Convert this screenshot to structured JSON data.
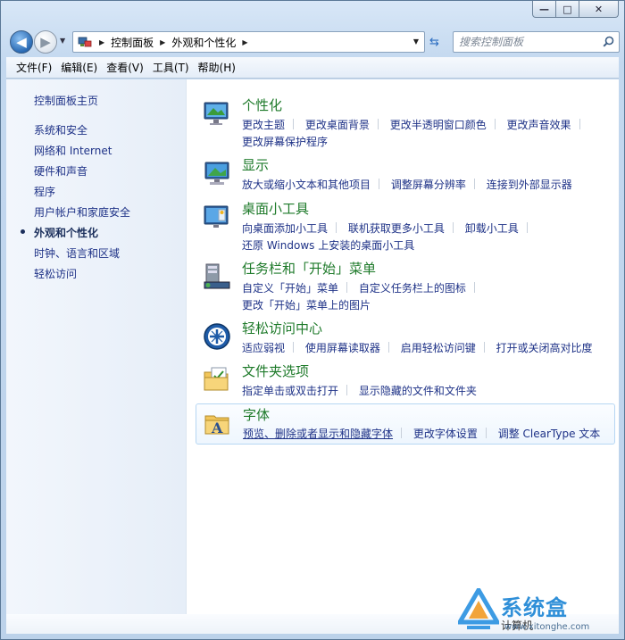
{
  "window": {
    "caption": {
      "min": "—",
      "max": "□",
      "close": "✕"
    }
  },
  "nav": {
    "back_icon": "arrow-left-icon",
    "forward_icon": "arrow-right-icon",
    "breadcrumbs": [
      "控制面板",
      "外观和个性化"
    ],
    "search_placeholder": "搜索控制面板"
  },
  "menubar": [
    "文件(F)",
    "编辑(E)",
    "查看(V)",
    "工具(T)",
    "帮助(H)"
  ],
  "sidebar": {
    "home": "控制面板主页",
    "items": [
      {
        "label": "系统和安全",
        "active": false
      },
      {
        "label": "网络和 Internet",
        "active": false
      },
      {
        "label": "硬件和声音",
        "active": false
      },
      {
        "label": "程序",
        "active": false
      },
      {
        "label": "用户帐户和家庭安全",
        "active": false
      },
      {
        "label": "外观和个性化",
        "active": true
      },
      {
        "label": "时钟、语言和区域",
        "active": false
      },
      {
        "label": "轻松访问",
        "active": false
      }
    ]
  },
  "categories": [
    {
      "title": "个性化",
      "icon": "personalization-icon",
      "rows": [
        [
          "更改主题",
          "更改桌面背景",
          "更改半透明窗口颜色",
          "更改声音效果"
        ],
        [
          "更改屏幕保护程序"
        ]
      ]
    },
    {
      "title": "显示",
      "icon": "display-icon",
      "rows": [
        [
          "放大或缩小文本和其他项目",
          "调整屏幕分辨率",
          "连接到外部显示器"
        ]
      ]
    },
    {
      "title": "桌面小工具",
      "icon": "gadgets-icon",
      "rows": [
        [
          "向桌面添加小工具",
          "联机获取更多小工具",
          "卸载小工具"
        ],
        [
          "还原 Windows 上安装的桌面小工具"
        ]
      ]
    },
    {
      "title": "任务栏和「开始」菜单",
      "icon": "taskbar-icon",
      "rows": [
        [
          "自定义「开始」菜单",
          "自定义任务栏上的图标"
        ],
        [
          "更改「开始」菜单上的图片"
        ]
      ]
    },
    {
      "title": "轻松访问中心",
      "icon": "ease-of-access-icon",
      "rows": [
        [
          "适应弱视",
          "使用屏幕读取器",
          "启用轻松访问键",
          "打开或关闭高对比度"
        ]
      ]
    },
    {
      "title": "文件夹选项",
      "icon": "folder-options-icon",
      "rows": [
        [
          "指定单击或双击打开",
          "显示隐藏的文件和文件夹"
        ]
      ]
    },
    {
      "title": "字体",
      "icon": "fonts-icon",
      "rows": [
        [
          "预览、删除或者显示和隐藏字体",
          "更改字体设置",
          "调整 ClearType 文本"
        ]
      ]
    }
  ],
  "status": {
    "text": "计算机"
  },
  "watermark": {
    "text": "系统盒",
    "url": "www.xitonghe.com"
  }
}
